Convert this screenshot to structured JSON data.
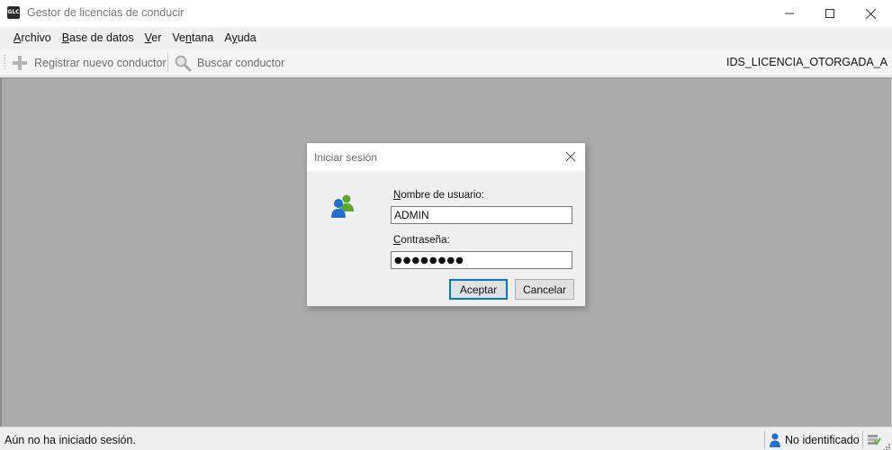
{
  "window": {
    "title": "Gestor de licencias de conducir",
    "app_icon_text": "GLC"
  },
  "menu": {
    "items": [
      {
        "accel": "A",
        "rest": "rchivo"
      },
      {
        "accel": "B",
        "rest": "ase de datos"
      },
      {
        "accel": "V",
        "rest": "er"
      },
      {
        "pre": "Ve",
        "accel": "n",
        "rest": "tana"
      },
      {
        "pre": "A",
        "accel": "y",
        "rest": "uda"
      }
    ]
  },
  "toolbar": {
    "register_label": "Registrar nuevo conductor",
    "register_icon": "plus-icon",
    "search_label": "Buscar conductor",
    "search_icon": "magnifier-icon",
    "right_label": "IDS_LICENCIA_OTORGADA_A"
  },
  "dialog": {
    "title": "Iniciar sesión",
    "icon": "users-icon",
    "user_label_accel": "N",
    "user_label_rest": "ombre de usuario:",
    "user_value": "ADMIN",
    "pass_label_accel": "C",
    "pass_label_rest": "ontraseña:",
    "pass_value": "●●●●●●●●",
    "ok_label": "Aceptar",
    "cancel_label": "Cancelar"
  },
  "status": {
    "message": "Aún no ha iniciado sesión.",
    "user_state": "No identificado",
    "user_icon": "user-icon",
    "db_icon": "database-icon"
  },
  "colors": {
    "workspace_bg": "#ababab",
    "focus_accent": "#0078d7",
    "user_icon_blue": "#1e6fd0",
    "user_icon_green": "#5aa832"
  }
}
